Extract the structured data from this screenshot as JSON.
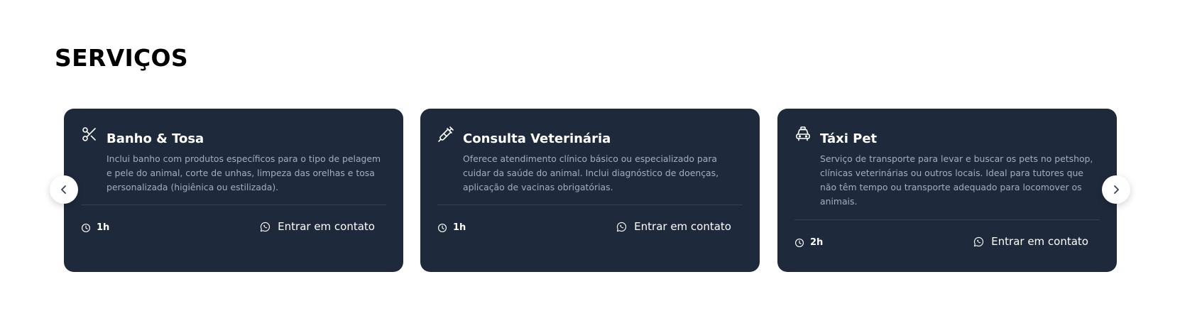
{
  "section": {
    "title": "SERVIÇOS"
  },
  "colors": {
    "card_bg": "#1e293b",
    "description": "#a3aebf",
    "divider": "#334155",
    "text": "#ffffff"
  },
  "carousel": {
    "prev_icon": "chevron-left-icon",
    "next_icon": "chevron-right-icon",
    "cards": [
      {
        "icon": "scissors-icon",
        "title": "Banho & Tosa",
        "description": "Inclui banho com produtos específicos para o tipo de pelagem e pele do animal, corte de unhas, limpeza das orelhas e tosa personalizada (higiênica ou estilizada).",
        "duration": "1h",
        "duration_icon": "clock-icon",
        "contact_icon": "whatsapp-icon",
        "contact_label": "Entrar em contato"
      },
      {
        "icon": "syringe-icon",
        "title": "Consulta Veterinária",
        "description": "Oferece atendimento clínico básico ou especializado para cuidar da saúde do animal. Inclui diagnóstico de doenças, aplicação de vacinas obrigatórias.",
        "duration": "1h",
        "duration_icon": "clock-icon",
        "contact_icon": "whatsapp-icon",
        "contact_label": "Entrar em contato"
      },
      {
        "icon": "taxi-icon",
        "title": "Táxi Pet",
        "description": "Serviço de transporte para levar e buscar os pets no petshop, clínicas veterinárias ou outros locais. Ideal para tutores que não têm tempo ou transporte adequado para locomover os animais.",
        "duration": "2h",
        "duration_icon": "clock-icon",
        "contact_icon": "whatsapp-icon",
        "contact_label": "Entrar em contato"
      }
    ]
  }
}
